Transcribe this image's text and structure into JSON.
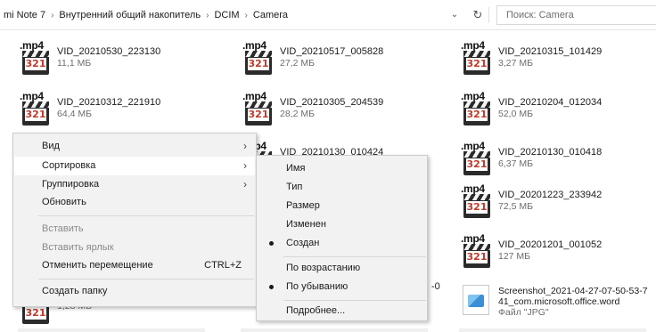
{
  "address": {
    "crumbs": [
      "mi Note 7",
      "Внутренний общий накопитель",
      "DCIM",
      "Camera"
    ],
    "separator": "›",
    "dropdown_icon": "chevron-down-icon",
    "refresh_icon": "refresh-icon",
    "search_placeholder": "Поиск: Camera"
  },
  "files": [
    {
      "name": "VID_20210530_223130",
      "size": "11,1 МБ"
    },
    {
      "name": "VID_20210517_005828",
      "size": "27,2 МБ"
    },
    {
      "name": "VID_20210315_101429",
      "size": "3,27 МБ"
    },
    {
      "name": "VID_20210312_221910",
      "size": "64,4 МБ"
    },
    {
      "name": "VID_20210305_204539",
      "size": "28,2 МБ"
    },
    {
      "name": "VID_20210204_012034",
      "size": "52,0 МБ"
    },
    {
      "name": "VID_20210130_010424",
      "size": ""
    },
    {
      "name": "VID_20210130_010418",
      "size": "6,37 МБ"
    },
    {
      "name": "VID_20201223_233942",
      "size": "72,5 МБ"
    },
    {
      "name": "VID_20201201_001052",
      "size": "127 МБ"
    },
    {
      "name": "",
      "size": "1,28 МБ"
    }
  ],
  "video_icon": {
    "tag": ".mp4",
    "number": "321"
  },
  "screenshot_file": {
    "line1": "Screenshot_2021-04-27-07-50-53-7",
    "line2": "41_com.microsoft.office.word",
    "line3": "Файл \"JPG\""
  },
  "partial_text": "-0",
  "context_menu": {
    "items": [
      {
        "label": "Вид",
        "submenu": true
      },
      {
        "label": "Сортировка",
        "submenu": true
      },
      {
        "label": "Группировка",
        "submenu": true
      },
      {
        "label": "Обновить"
      },
      {
        "label": "Вставить",
        "disabled": true
      },
      {
        "label": "Вставить ярлык",
        "disabled": true
      },
      {
        "label": "Отменить перемещение",
        "shortcut": "CTRL+Z"
      },
      {
        "label": "Создать папку"
      }
    ],
    "arrow": "›"
  },
  "sort_submenu": {
    "items": [
      {
        "label": "Имя"
      },
      {
        "label": "Тип"
      },
      {
        "label": "Размер"
      },
      {
        "label": "Изменен"
      },
      {
        "label": "Создан",
        "selected": true
      },
      {
        "label": "По возрастанию"
      },
      {
        "label": "По убыванию",
        "selected": true
      },
      {
        "label": "Подробнее..."
      }
    ]
  }
}
